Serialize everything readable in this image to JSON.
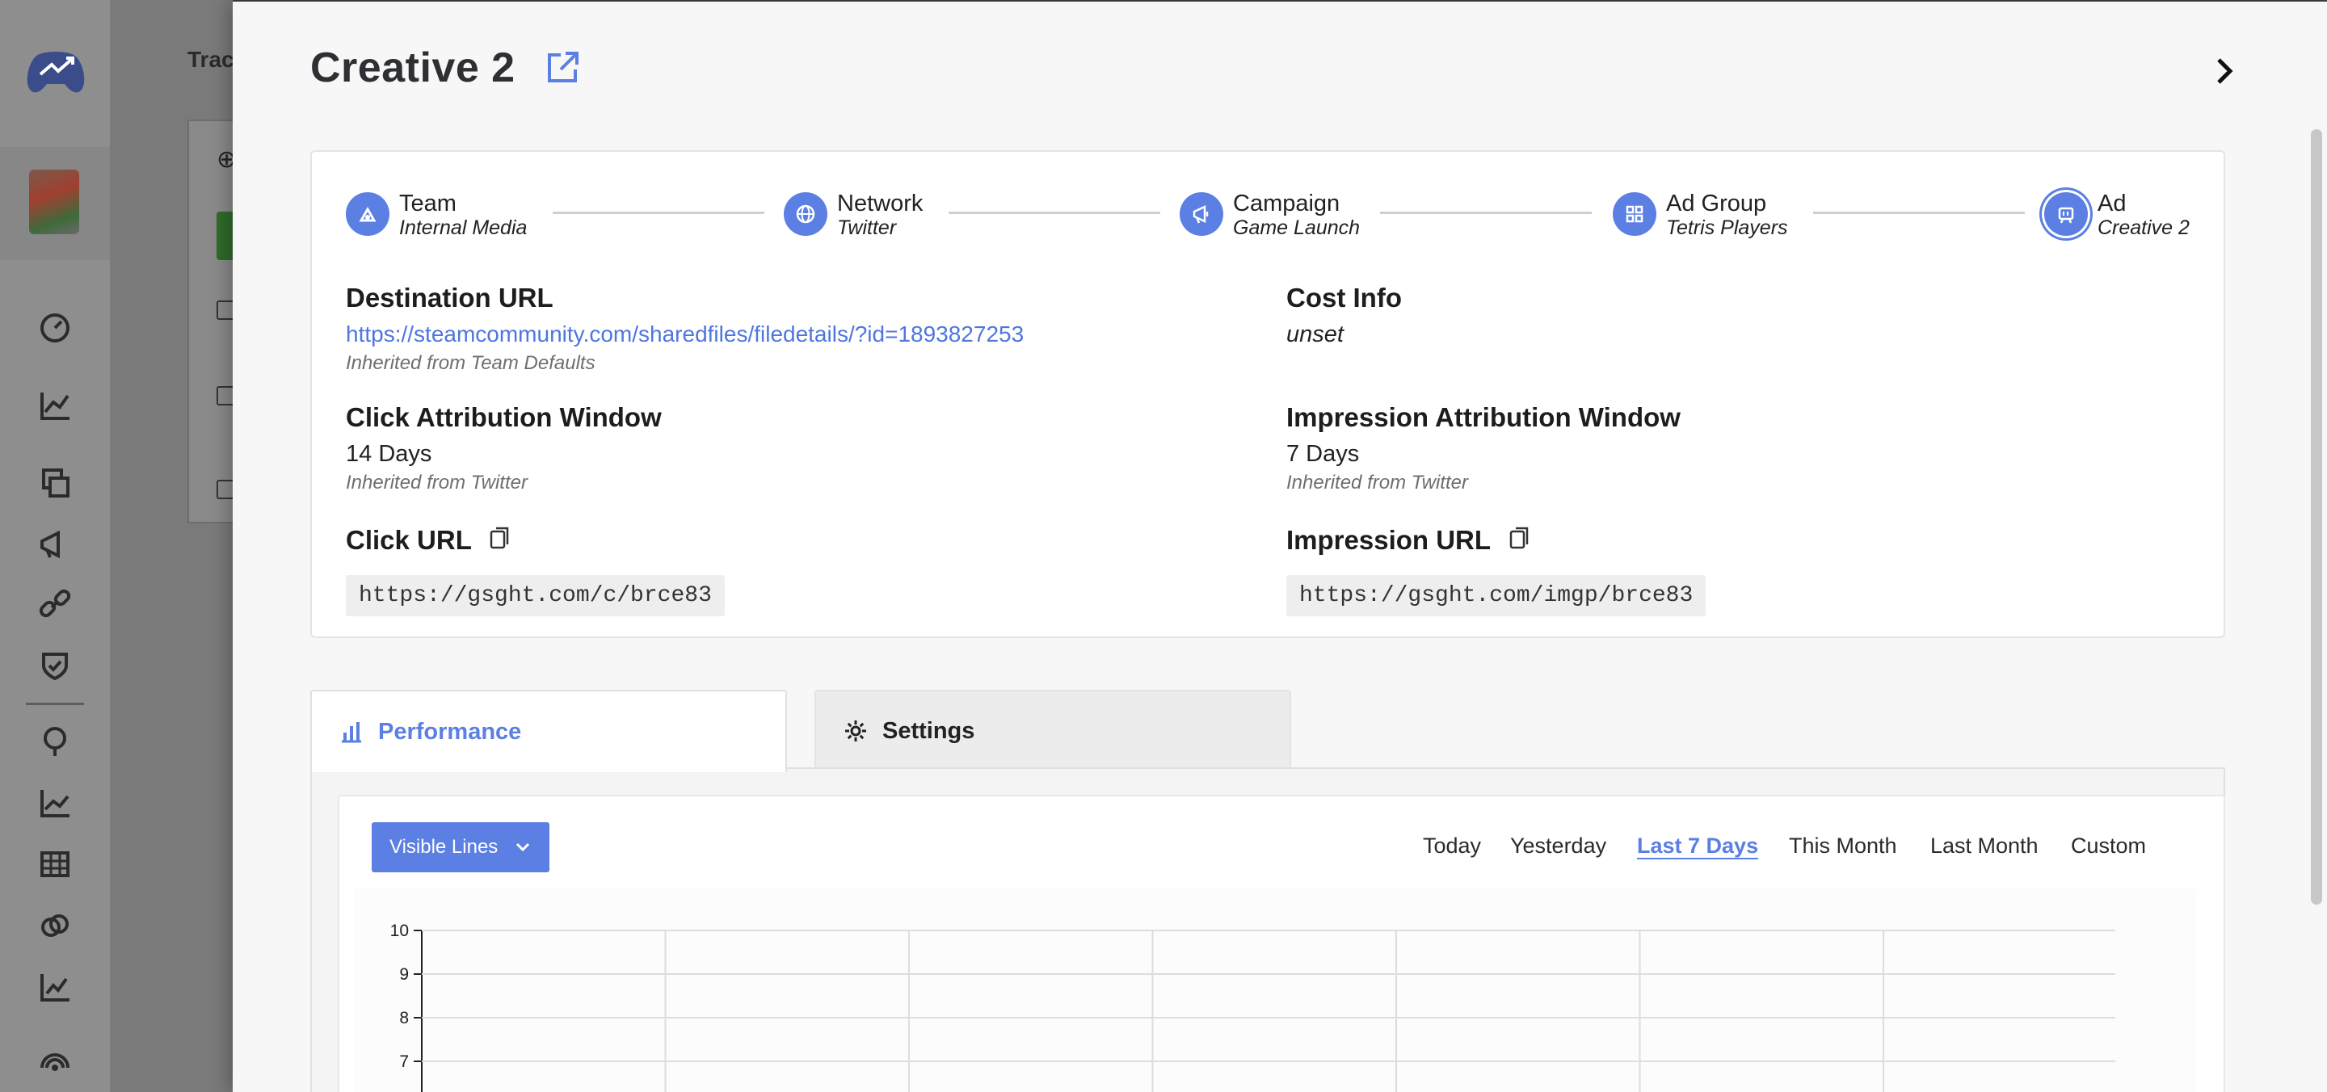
{
  "background": {
    "page_title": "Trac"
  },
  "drawer": {
    "title": "Creative 2",
    "breadcrumb": [
      {
        "label": "Team",
        "value": "Internal Media",
        "icon": "team-icon"
      },
      {
        "label": "Network",
        "value": "Twitter",
        "icon": "globe-icon"
      },
      {
        "label": "Campaign",
        "value": "Game Launch",
        "icon": "megaphone-icon"
      },
      {
        "label": "Ad Group",
        "value": "Tetris Players",
        "icon": "grid-icon"
      },
      {
        "label": "Ad",
        "value": "Creative 2",
        "icon": "ad-icon"
      }
    ],
    "destination": {
      "title": "Destination URL",
      "url": "https://steamcommunity.com/sharedfiles/filedetails/?id=1893827253",
      "note": "Inherited from Team Defaults"
    },
    "cost": {
      "title": "Cost Info",
      "value": "unset"
    },
    "click_window": {
      "title": "Click Attribution Window",
      "value": "14 Days",
      "note": "Inherited from Twitter"
    },
    "impression_window": {
      "title": "Impression Attribution Window",
      "value": "7 Days",
      "note": "Inherited from Twitter"
    },
    "click_url": {
      "title": "Click URL",
      "value": "https://gsght.com/c/brce83"
    },
    "impression_url": {
      "title": "Impression URL",
      "value": "https://gsght.com/imgp/brce83"
    },
    "tabs": [
      {
        "label": "Performance",
        "active": true
      },
      {
        "label": "Settings",
        "active": false
      }
    ],
    "visible_lines_label": "Visible Lines",
    "date_ranges": [
      "Today",
      "Yesterday",
      "Last 7 Days",
      "This Month",
      "Last Month",
      "Custom"
    ],
    "active_range": "Last 7 Days"
  },
  "colors": {
    "accent": "#5b7fe3",
    "drawer_bg": "#f7f7f7",
    "overlay": "#7a7a7a"
  },
  "chart_data": {
    "type": "line",
    "title": "",
    "xlabel": "",
    "ylabel": "",
    "y_ticks": [
      10,
      9,
      8,
      7
    ],
    "ylim": [
      0,
      10
    ],
    "series": [],
    "grid": true
  }
}
